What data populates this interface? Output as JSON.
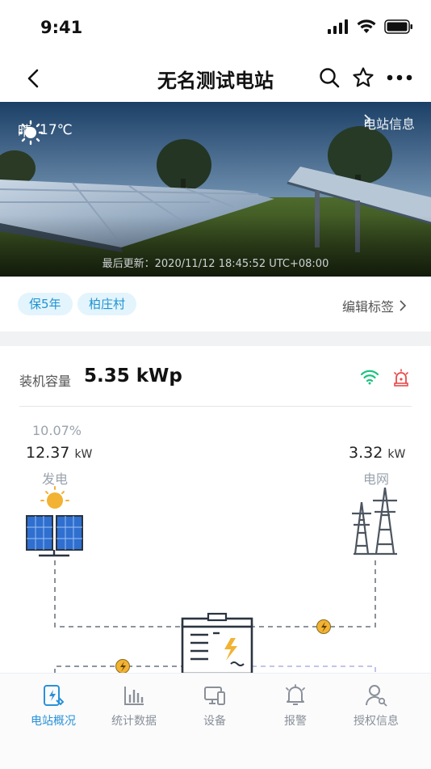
{
  "status_bar": {
    "time": "9:41"
  },
  "nav": {
    "title": "无名测试电站"
  },
  "hero": {
    "weather_condition": "晴",
    "temperature": "17℃",
    "station_info_link": "电站信息",
    "last_update": "最后更新：2020/11/12 18:45:52 UTC+08:00"
  },
  "tags": {
    "items": [
      "保5年",
      "柏庄村"
    ],
    "edit_label": "编辑标签"
  },
  "capacity": {
    "label": "装机容量",
    "value": "5.35 kWp"
  },
  "flow": {
    "generation_percent": "10.07%",
    "generation_value": "12.37",
    "generation_unit": "kW",
    "generation_label": "发电",
    "grid_value": "3.32",
    "grid_unit": "kW",
    "grid_label": "电网"
  },
  "tabbar": {
    "items": [
      "电站概况",
      "统计数据",
      "设备",
      "报警",
      "授权信息"
    ],
    "active_index": 0
  },
  "colors": {
    "accent": "#2a91d8",
    "tag_bg": "#e3f4fc",
    "wifi_ok": "#19c37d",
    "alarm": "#e84a4a",
    "energy_dot": "#f2b233"
  },
  "icons": [
    "back-icon",
    "search-icon",
    "star-icon",
    "more-icon",
    "sun-icon",
    "chevron-right-icon",
    "wifi-icon",
    "alarm-icon",
    "solar-panel-icon",
    "power-tower-icon",
    "battery-icon",
    "lightning-icon"
  ]
}
